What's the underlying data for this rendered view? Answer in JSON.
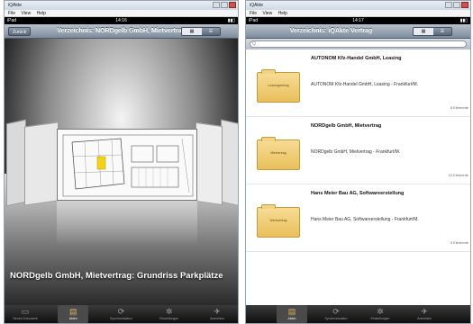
{
  "left": {
    "window": {
      "title": "iQAkte",
      "menu": [
        "File",
        "View",
        "Help"
      ]
    },
    "status": {
      "carrier": "iPad",
      "time": "14:16",
      "battery": ""
    },
    "nav": {
      "back": "Zurück",
      "title": "Verzeichnis: NORDgelb GmbH, Mietvertrag",
      "seg": [
        "",
        ""
      ]
    },
    "caption": "NORDgelb GmbH, Mietvertrag: Grundriss Parkplätze",
    "tabs": [
      {
        "label": "Neues Dokument",
        "icon": "▭"
      },
      {
        "label": "Akten",
        "icon": "▤"
      },
      {
        "label": "Synchronisation",
        "icon": "⟳"
      },
      {
        "label": "Einstellungen",
        "icon": "✲"
      },
      {
        "label": "Anmelden",
        "icon": "✈"
      }
    ]
  },
  "right": {
    "window": {
      "title": "iQAkte",
      "menu": [
        "File",
        "View",
        "Help"
      ]
    },
    "status": {
      "carrier": "iPad",
      "time": "14:17",
      "battery": ""
    },
    "nav": {
      "title": "Verzeichnis: iQAkte Vertrag",
      "seg": [
        "",
        ""
      ]
    },
    "search": {
      "placeholder": "Q"
    },
    "rows": [
      {
        "title": "AUTONOM Kfz-Handel GmbH, Leasing",
        "subtitle": "AUTONOM Kfz-Handel GmbH, Leasing - Frankfurt/M.",
        "count": "8 Elemente",
        "folder": "Leasingvertrag"
      },
      {
        "title": "NORDgelb GmbH, Mietvertrag",
        "subtitle": "NORDgelb GmbH, Mietvertrag - Frankfurt/M.",
        "count": "10 Elemente",
        "folder": "Mietvertrag"
      },
      {
        "title": "Hans Meier Bau AG, Softwareerstellung",
        "subtitle": "Hans Meier Bau AG, Softwareerstellung - Frankfurt/M.",
        "count": "3 Elemente",
        "folder": "Werkvertrag"
      }
    ],
    "tabs": [
      {
        "label": "Akten",
        "icon": "▤"
      },
      {
        "label": "Synchronisation",
        "icon": "⟳"
      },
      {
        "label": "Einstellungen",
        "icon": "✲"
      },
      {
        "label": "Anmelden",
        "icon": "✈"
      }
    ]
  },
  "colors": {
    "folder": "#e9bf5c",
    "navbar": "#7c8b9c",
    "active_tab_icon": "#d8b25c"
  }
}
